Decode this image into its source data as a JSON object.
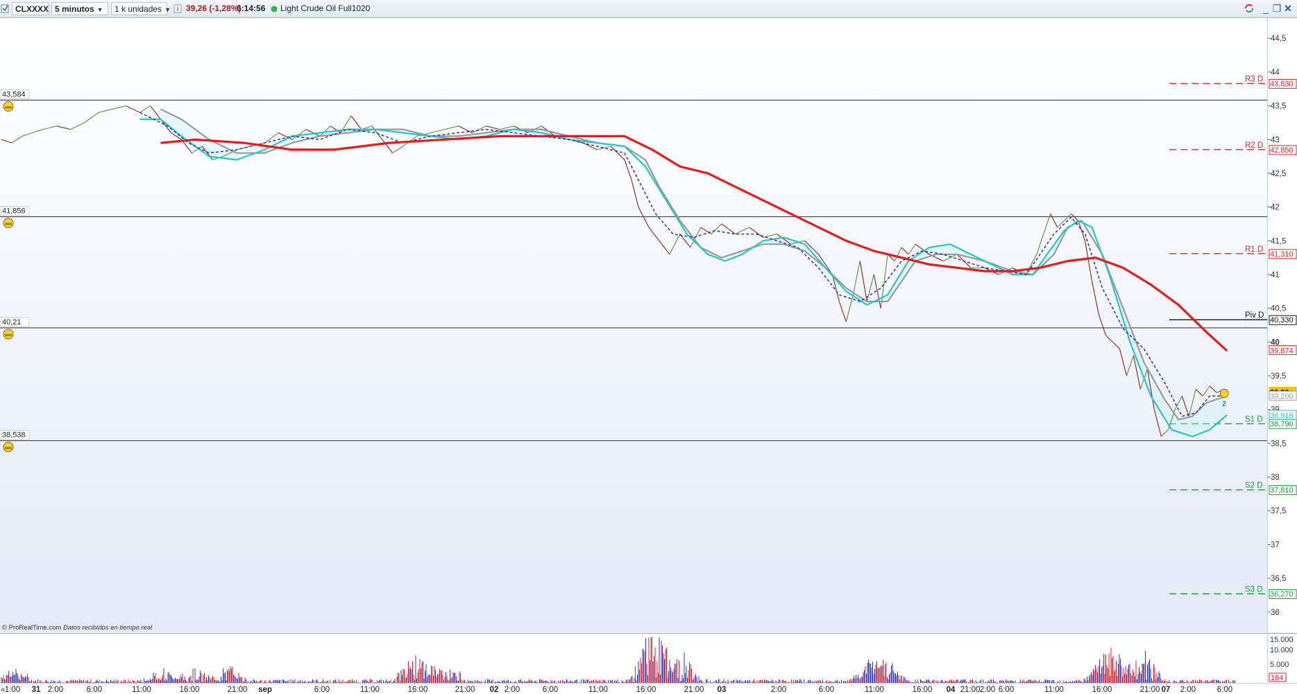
{
  "toolbar": {
    "symbol": "CLXXXX",
    "timeframe": "5 minutos",
    "units": "1 k unidades",
    "price_change": "39,26 (-1,28%)",
    "time": "6:14:56",
    "instrument": "Light Crude Oil Full1020"
  },
  "colors": {
    "bullish": "#5a8f3a",
    "bearish": "#8a1f1f",
    "ma_long": "#e31b1b",
    "ma_mid": "#999999",
    "ma_fast": "#2ac3c8",
    "ma_dash": "#2230a8",
    "resistance": "#e0242a",
    "support": "#1f9a3a"
  },
  "credit": {
    "brand": "© ProRealTime.com",
    "note": "Datos recibidos en tiempo real"
  },
  "price_axis": {
    "ticks": [
      "44,5",
      "44",
      "43,5",
      "43",
      "42,5",
      "42",
      "41,5",
      "41",
      "40,5",
      "40",
      "39,5",
      "39",
      "38,5",
      "38",
      "37,5",
      "37",
      "36,5",
      "36"
    ]
  },
  "horizontal_lines": [
    {
      "label": "43,584",
      "value": 43.584
    },
    {
      "label": "41,856",
      "value": 41.856
    },
    {
      "label": "40,21",
      "value": 40.21
    },
    {
      "label": "38,538",
      "value": 38.538
    }
  ],
  "pivots": [
    {
      "name": "R3 D",
      "value_label": "43,830",
      "value": 43.83,
      "kind": "resistance"
    },
    {
      "name": "R2 D",
      "value_label": "42,850",
      "value": 42.85,
      "kind": "resistance"
    },
    {
      "name": "R1 D",
      "value_label": "41,310",
      "value": 41.31,
      "kind": "resistance"
    },
    {
      "name": "Piv D",
      "value_label": "40,330",
      "value": 40.33,
      "kind": "pivot"
    },
    {
      "name": "S1 D",
      "value_label": "38,790",
      "value": 38.79,
      "kind": "support"
    },
    {
      "name": "S2 D",
      "value_label": "37,810",
      "value": 37.81,
      "kind": "support"
    },
    {
      "name": "S3 D",
      "value_label": "36,270",
      "value": 36.27,
      "kind": "support"
    }
  ],
  "axis_markers": [
    {
      "label": "39,874",
      "value": 39.874,
      "color": "#e0242a"
    },
    {
      "label": "39,26",
      "value": 39.26,
      "color": "#f2c200"
    },
    {
      "label": "39,200",
      "value": 39.2,
      "color": "#999999"
    },
    {
      "label": "38,916",
      "value": 38.916,
      "color": "#2ac3c8"
    },
    {
      "label": "38,790",
      "value": 38.79,
      "color": "#1f9a3a"
    }
  ],
  "alert_badge": "2",
  "volume_axis": {
    "ticks": [
      "15.000",
      "10.000",
      "5.000"
    ],
    "current": "184"
  },
  "time_axis": {
    "labels": [
      "1:00",
      "31",
      "2:00",
      "6:00",
      "11:00",
      "16:00",
      "21:00",
      "sep",
      "6:00",
      "11:00",
      "16:00",
      "21:00",
      "02",
      "2:00",
      "6:00",
      "11:00",
      "16:00",
      "21:00",
      "03",
      "2:00",
      "6:00",
      "11:00",
      "16:00",
      "21:00",
      "04",
      "2:00",
      "6:00",
      "11:00",
      "16:00",
      "21:00",
      "07",
      "2:00",
      "6:00"
    ],
    "bold": [
      "31",
      "sep",
      "02",
      "03",
      "04",
      "07"
    ]
  },
  "chart_data": {
    "type": "line",
    "title": "Light Crude Oil Full1020",
    "ylim": [
      35.7,
      44.8
    ],
    "price_path": [
      [
        0,
        43.0
      ],
      [
        15,
        42.95
      ],
      [
        30,
        43.05
      ],
      [
        45,
        43.1
      ],
      [
        60,
        43.15
      ],
      [
        80,
        43.2
      ],
      [
        100,
        43.15
      ],
      [
        120,
        43.25
      ],
      [
        140,
        43.4
      ],
      [
        160,
        43.45
      ],
      [
        180,
        43.5
      ],
      [
        200,
        43.4
      ],
      [
        215,
        43.5
      ],
      [
        230,
        43.3
      ],
      [
        245,
        43.1
      ],
      [
        260,
        43.0
      ],
      [
        275,
        42.8
      ],
      [
        290,
        42.9
      ],
      [
        305,
        42.7
      ],
      [
        320,
        42.75
      ],
      [
        340,
        42.85
      ],
      [
        360,
        42.9
      ],
      [
        380,
        42.95
      ],
      [
        400,
        43.1
      ],
      [
        420,
        43.0
      ],
      [
        440,
        43.15
      ],
      [
        460,
        43.05
      ],
      [
        475,
        43.2
      ],
      [
        490,
        43.1
      ],
      [
        505,
        43.35
      ],
      [
        520,
        43.15
      ],
      [
        535,
        43.2
      ],
      [
        550,
        43.0
      ],
      [
        565,
        42.8
      ],
      [
        580,
        42.9
      ],
      [
        600,
        43.05
      ],
      [
        620,
        43.1
      ],
      [
        640,
        43.15
      ],
      [
        660,
        43.2
      ],
      [
        680,
        43.1
      ],
      [
        700,
        43.2
      ],
      [
        720,
        43.15
      ],
      [
        740,
        43.2
      ],
      [
        760,
        43.1
      ],
      [
        780,
        43.2
      ],
      [
        800,
        43.05
      ],
      [
        820,
        43.0
      ],
      [
        840,
        42.95
      ],
      [
        860,
        42.85
      ],
      [
        880,
        42.9
      ],
      [
        900,
        42.7
      ],
      [
        910,
        42.4
      ],
      [
        920,
        42.0
      ],
      [
        935,
        41.7
      ],
      [
        950,
        41.5
      ],
      [
        965,
        41.3
      ],
      [
        980,
        41.6
      ],
      [
        995,
        41.4
      ],
      [
        1010,
        41.7
      ],
      [
        1025,
        41.6
      ],
      [
        1040,
        41.75
      ],
      [
        1060,
        41.6
      ],
      [
        1080,
        41.7
      ],
      [
        1100,
        41.55
      ],
      [
        1120,
        41.6
      ],
      [
        1140,
        41.45
      ],
      [
        1160,
        41.5
      ],
      [
        1180,
        41.3
      ],
      [
        1200,
        41.0
      ],
      [
        1210,
        40.6
      ],
      [
        1220,
        40.3
      ],
      [
        1230,
        40.7
      ],
      [
        1240,
        41.2
      ],
      [
        1250,
        40.6
      ],
      [
        1260,
        41.0
      ],
      [
        1270,
        40.5
      ],
      [
        1280,
        41.3
      ],
      [
        1290,
        41.2
      ],
      [
        1300,
        41.4
      ],
      [
        1310,
        41.3
      ],
      [
        1320,
        41.45
      ],
      [
        1340,
        41.3
      ],
      [
        1360,
        41.2
      ],
      [
        1380,
        41.3
      ],
      [
        1400,
        41.1
      ],
      [
        1420,
        41.1
      ],
      [
        1440,
        41.0
      ],
      [
        1460,
        41.1
      ],
      [
        1480,
        41.0
      ],
      [
        1495,
        41.3
      ],
      [
        1505,
        41.6
      ],
      [
        1515,
        41.9
      ],
      [
        1525,
        41.7
      ],
      [
        1535,
        41.8
      ],
      [
        1545,
        41.9
      ],
      [
        1555,
        41.8
      ],
      [
        1565,
        41.5
      ],
      [
        1575,
        40.9
      ],
      [
        1585,
        40.4
      ],
      [
        1595,
        40.1
      ],
      [
        1605,
        40.0
      ],
      [
        1615,
        39.9
      ],
      [
        1625,
        39.5
      ],
      [
        1635,
        39.8
      ],
      [
        1645,
        39.3
      ],
      [
        1655,
        39.6
      ],
      [
        1665,
        39.0
      ],
      [
        1675,
        38.6
      ],
      [
        1685,
        38.7
      ],
      [
        1695,
        39.0
      ],
      [
        1705,
        39.2
      ],
      [
        1715,
        38.9
      ],
      [
        1725,
        39.3
      ],
      [
        1735,
        39.2
      ],
      [
        1745,
        39.35
      ],
      [
        1755,
        39.25
      ],
      [
        1765,
        39.3
      ],
      [
        1768,
        39.26
      ]
    ],
    "series": [
      {
        "name": "ma_long",
        "points": [
          [
            230,
            42.95
          ],
          [
            280,
            43.0
          ],
          [
            350,
            42.95
          ],
          [
            420,
            42.85
          ],
          [
            480,
            42.85
          ],
          [
            560,
            42.95
          ],
          [
            640,
            43.0
          ],
          [
            720,
            43.05
          ],
          [
            800,
            43.05
          ],
          [
            860,
            43.05
          ],
          [
            900,
            43.05
          ],
          [
            940,
            42.85
          ],
          [
            980,
            42.6
          ],
          [
            1020,
            42.5
          ],
          [
            1060,
            42.3
          ],
          [
            1100,
            42.1
          ],
          [
            1140,
            41.9
          ],
          [
            1180,
            41.7
          ],
          [
            1220,
            41.5
          ],
          [
            1260,
            41.35
          ],
          [
            1300,
            41.25
          ],
          [
            1340,
            41.15
          ],
          [
            1380,
            41.1
          ],
          [
            1420,
            41.05
          ],
          [
            1460,
            41.05
          ],
          [
            1500,
            41.1
          ],
          [
            1540,
            41.2
          ],
          [
            1580,
            41.25
          ],
          [
            1620,
            41.1
          ],
          [
            1660,
            40.85
          ],
          [
            1700,
            40.55
          ],
          [
            1740,
            40.15
          ],
          [
            1770,
            39.87
          ]
        ]
      },
      {
        "name": "ma_mid",
        "points": [
          [
            230,
            43.45
          ],
          [
            260,
            43.3
          ],
          [
            300,
            43.0
          ],
          [
            340,
            42.8
          ],
          [
            380,
            42.8
          ],
          [
            420,
            42.95
          ],
          [
            460,
            43.05
          ],
          [
            500,
            43.1
          ],
          [
            540,
            43.15
          ],
          [
            580,
            43.15
          ],
          [
            620,
            43.05
          ],
          [
            660,
            43.05
          ],
          [
            700,
            43.1
          ],
          [
            740,
            43.15
          ],
          [
            780,
            43.15
          ],
          [
            820,
            43.05
          ],
          [
            860,
            42.95
          ],
          [
            900,
            42.9
          ],
          [
            930,
            42.7
          ],
          [
            950,
            42.3
          ],
          [
            980,
            41.8
          ],
          [
            1010,
            41.4
          ],
          [
            1040,
            41.25
          ],
          [
            1070,
            41.35
          ],
          [
            1100,
            41.45
          ],
          [
            1130,
            41.45
          ],
          [
            1160,
            41.35
          ],
          [
            1190,
            41.1
          ],
          [
            1220,
            40.8
          ],
          [
            1250,
            40.6
          ],
          [
            1280,
            40.6
          ],
          [
            1300,
            40.9
          ],
          [
            1320,
            41.2
          ],
          [
            1350,
            41.3
          ],
          [
            1380,
            41.3
          ],
          [
            1420,
            41.2
          ],
          [
            1460,
            41.05
          ],
          [
            1490,
            41.0
          ],
          [
            1520,
            41.3
          ],
          [
            1540,
            41.7
          ],
          [
            1560,
            41.8
          ],
          [
            1590,
            41.3
          ],
          [
            1620,
            40.5
          ],
          [
            1650,
            39.7
          ],
          [
            1680,
            39.15
          ],
          [
            1700,
            38.85
          ],
          [
            1720,
            38.9
          ],
          [
            1740,
            39.1
          ],
          [
            1770,
            39.2
          ]
        ]
      },
      {
        "name": "ma_fast",
        "points": [
          [
            200,
            43.3
          ],
          [
            230,
            43.3
          ],
          [
            260,
            43.05
          ],
          [
            300,
            42.75
          ],
          [
            340,
            42.7
          ],
          [
            380,
            42.85
          ],
          [
            420,
            43.05
          ],
          [
            460,
            43.1
          ],
          [
            500,
            43.15
          ],
          [
            540,
            43.15
          ],
          [
            580,
            43.1
          ],
          [
            620,
            43.05
          ],
          [
            660,
            43.0
          ],
          [
            700,
            43.05
          ],
          [
            740,
            43.15
          ],
          [
            780,
            43.1
          ],
          [
            820,
            43.0
          ],
          [
            860,
            42.95
          ],
          [
            900,
            42.9
          ],
          [
            930,
            42.6
          ],
          [
            960,
            42.1
          ],
          [
            990,
            41.6
          ],
          [
            1020,
            41.3
          ],
          [
            1045,
            41.2
          ],
          [
            1070,
            41.3
          ],
          [
            1100,
            41.5
          ],
          [
            1130,
            41.55
          ],
          [
            1160,
            41.45
          ],
          [
            1190,
            41.1
          ],
          [
            1220,
            40.75
          ],
          [
            1250,
            40.55
          ],
          [
            1280,
            40.7
          ],
          [
            1310,
            41.2
          ],
          [
            1340,
            41.4
          ],
          [
            1370,
            41.45
          ],
          [
            1400,
            41.3
          ],
          [
            1430,
            41.15
          ],
          [
            1460,
            41.0
          ],
          [
            1490,
            41.0
          ],
          [
            1510,
            41.3
          ],
          [
            1535,
            41.65
          ],
          [
            1555,
            41.8
          ],
          [
            1575,
            41.7
          ],
          [
            1600,
            41.0
          ],
          [
            1630,
            40.0
          ],
          [
            1660,
            39.2
          ],
          [
            1690,
            38.7
          ],
          [
            1720,
            38.6
          ],
          [
            1745,
            38.7
          ],
          [
            1770,
            38.92
          ]
        ]
      },
      {
        "name": "ma_dash",
        "points": [
          [
            200,
            43.4
          ],
          [
            240,
            43.2
          ],
          [
            270,
            42.95
          ],
          [
            300,
            42.8
          ],
          [
            340,
            42.85
          ],
          [
            380,
            42.95
          ],
          [
            420,
            43.05
          ],
          [
            460,
            43.0
          ],
          [
            500,
            43.15
          ],
          [
            540,
            43.1
          ],
          [
            580,
            42.95
          ],
          [
            620,
            43.05
          ],
          [
            660,
            43.1
          ],
          [
            700,
            43.15
          ],
          [
            740,
            43.1
          ],
          [
            780,
            43.05
          ],
          [
            820,
            43.0
          ],
          [
            860,
            42.9
          ],
          [
            900,
            42.8
          ],
          [
            920,
            42.4
          ],
          [
            945,
            41.9
          ],
          [
            970,
            41.6
          ],
          [
            1000,
            41.55
          ],
          [
            1030,
            41.65
          ],
          [
            1060,
            41.6
          ],
          [
            1090,
            41.6
          ],
          [
            1120,
            41.5
          ],
          [
            1150,
            41.4
          ],
          [
            1180,
            41.1
          ],
          [
            1210,
            40.7
          ],
          [
            1240,
            40.6
          ],
          [
            1270,
            40.8
          ],
          [
            1300,
            41.2
          ],
          [
            1330,
            41.35
          ],
          [
            1360,
            41.3
          ],
          [
            1390,
            41.2
          ],
          [
            1420,
            41.1
          ],
          [
            1450,
            41.05
          ],
          [
            1480,
            41.0
          ],
          [
            1500,
            41.3
          ],
          [
            1520,
            41.6
          ],
          [
            1545,
            41.85
          ],
          [
            1565,
            41.6
          ],
          [
            1590,
            40.8
          ],
          [
            1620,
            40.2
          ],
          [
            1650,
            39.9
          ],
          [
            1680,
            39.4
          ],
          [
            1705,
            38.9
          ],
          [
            1725,
            38.95
          ],
          [
            1745,
            39.2
          ],
          [
            1770,
            39.2
          ]
        ]
      }
    ]
  }
}
